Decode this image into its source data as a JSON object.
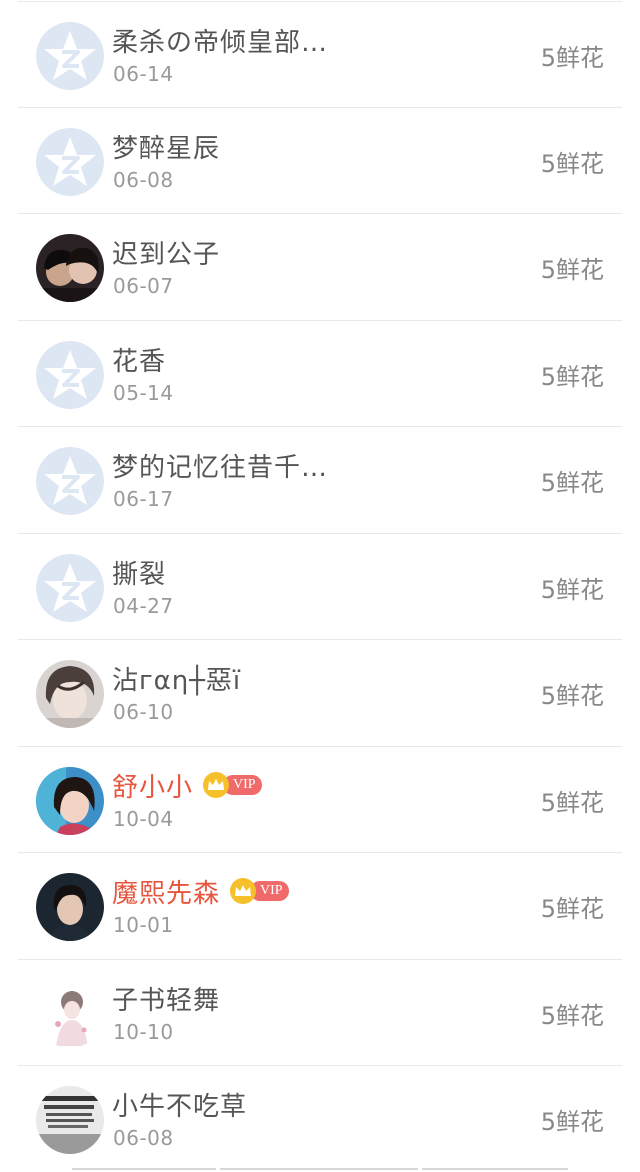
{
  "records": [
    {
      "name": "柔杀の帝倾皇部…",
      "date": "06-14",
      "gift": "5鲜花",
      "avatar": "default-qq-star-icon",
      "vip": false
    },
    {
      "name": "梦醉星辰",
      "date": "06-08",
      "gift": "5鲜花",
      "avatar": "default-qq-star-icon",
      "vip": false
    },
    {
      "name": "迟到公子",
      "date": "06-07",
      "gift": "5鲜花",
      "avatar": "couple-photo",
      "vip": false
    },
    {
      "name": "花香",
      "date": "05-14",
      "gift": "5鲜花",
      "avatar": "default-qq-star-icon",
      "vip": false
    },
    {
      "name": "梦的记忆往昔千…",
      "date": "06-17",
      "gift": "5鲜花",
      "avatar": "default-qq-star-icon",
      "vip": false
    },
    {
      "name": "撕裂",
      "date": "04-27",
      "gift": "5鲜花",
      "avatar": "default-qq-star-icon",
      "vip": false
    },
    {
      "name": "沾гαη┼惡ï",
      "date": "06-10",
      "gift": "5鲜花",
      "avatar": "boy-portrait-photo",
      "vip": false
    },
    {
      "name": "舒小小",
      "date": "10-04",
      "gift": "5鲜花",
      "avatar": "girl-portrait-photo",
      "vip": true,
      "vip_label": "VIP"
    },
    {
      "name": "魔熙先森",
      "date": "10-01",
      "gift": "5鲜花",
      "avatar": "man-portrait-photo",
      "vip": true,
      "vip_label": "VIP"
    },
    {
      "name": "子书轻舞",
      "date": "10-10",
      "gift": "5鲜花",
      "avatar": "girl-illustration",
      "vip": false
    },
    {
      "name": "小牛不吃草",
      "date": "06-08",
      "gift": "5鲜花",
      "avatar": "poster-text-image",
      "vip": false
    }
  ],
  "colors": {
    "vip_name": "#e8553e",
    "vip_tag": "#f06a6a",
    "crown": "#f6c02a",
    "default_avatar_bg": "#dde6f3"
  }
}
